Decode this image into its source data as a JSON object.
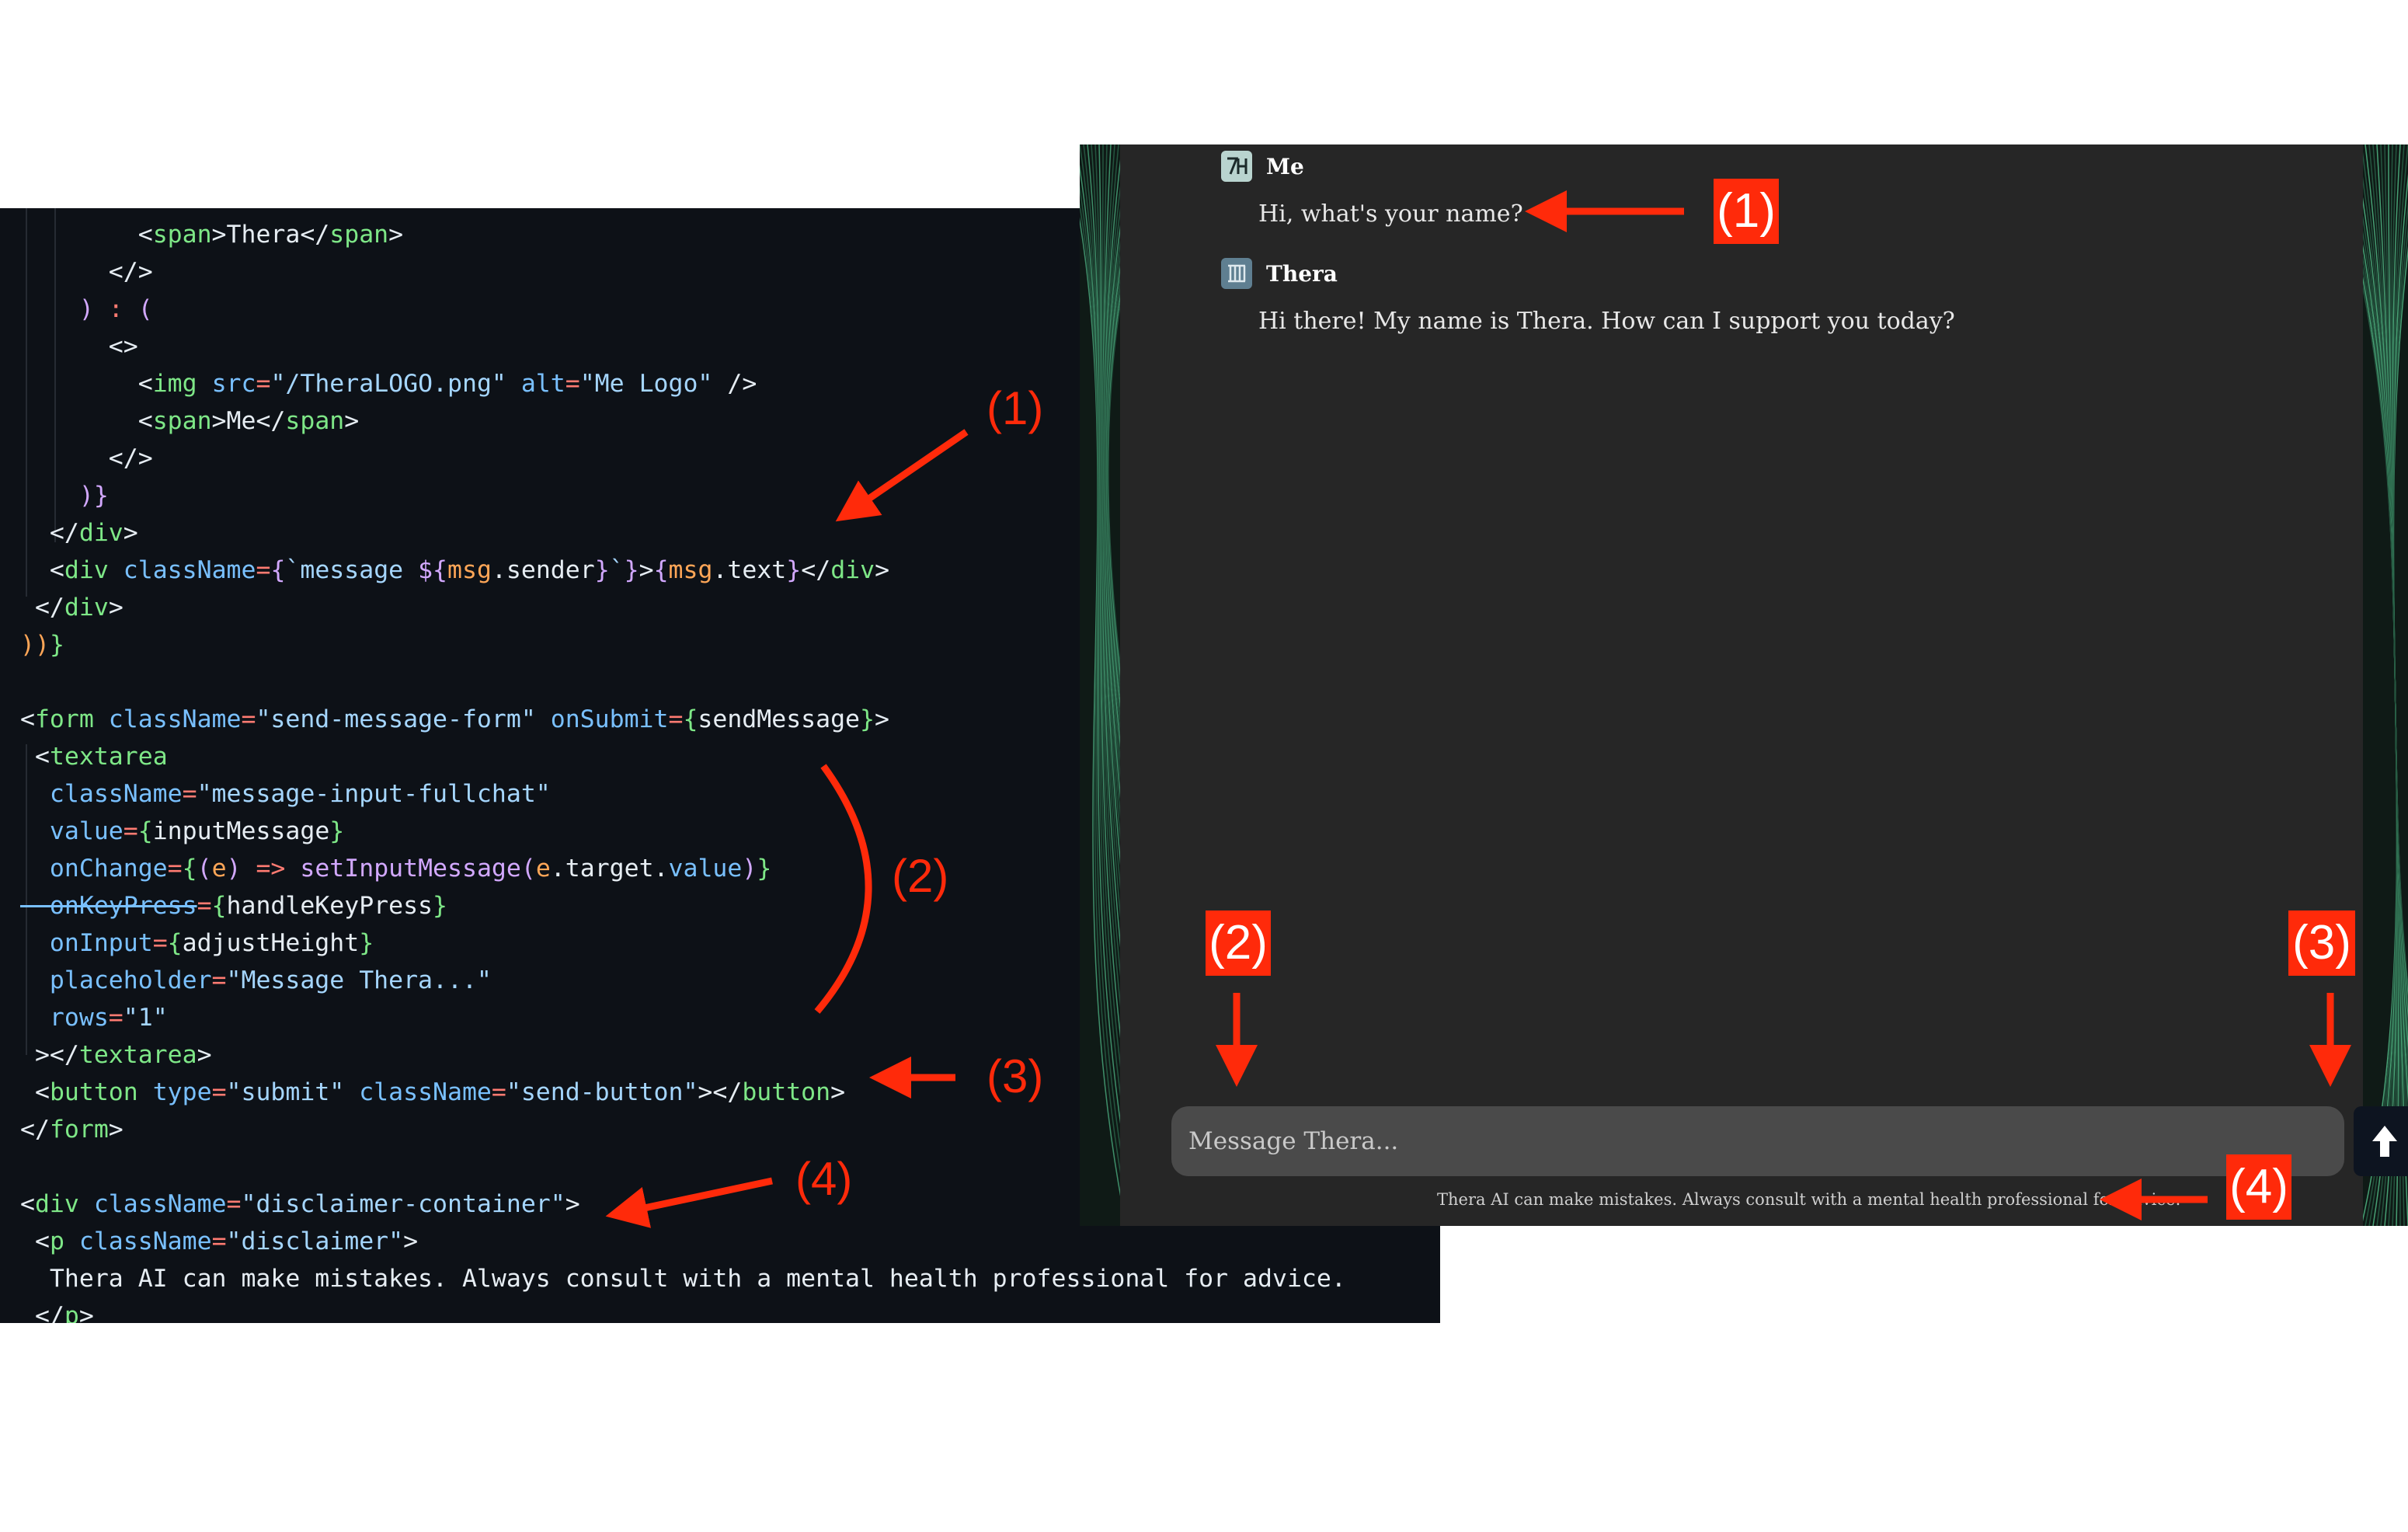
{
  "code": {
    "lines": [
      [
        [
          "br",
          "        <"
        ],
        [
          "tag",
          "span"
        ],
        [
          "br",
          ">"
        ],
        [
          "txt",
          "Thera"
        ],
        [
          "br",
          "</"
        ],
        [
          "tag",
          "span"
        ],
        [
          "br",
          ">"
        ]
      ],
      [
        [
          "br",
          "      </>"
        ]
      ],
      [
        [
          "brp",
          "    ) "
        ],
        [
          "eq",
          ":"
        ],
        [
          "brp",
          " ("
        ]
      ],
      [
        [
          "br",
          "      <>"
        ]
      ],
      [
        [
          "br",
          "        <"
        ],
        [
          "tag",
          "img"
        ],
        [
          "txt",
          " "
        ],
        [
          "attr",
          "src"
        ],
        [
          "eq",
          "="
        ],
        [
          "str",
          "\"/TheraLOGO.png\""
        ],
        [
          "txt",
          " "
        ],
        [
          "attr",
          "alt"
        ],
        [
          "eq",
          "="
        ],
        [
          "str",
          "\"Me Logo\""
        ],
        [
          "br",
          " />"
        ]
      ],
      [
        [
          "br",
          "        <"
        ],
        [
          "tag",
          "span"
        ],
        [
          "br",
          ">"
        ],
        [
          "txt",
          "Me"
        ],
        [
          "br",
          "</"
        ],
        [
          "tag",
          "span"
        ],
        [
          "br",
          ">"
        ]
      ],
      [
        [
          "br",
          "      </>"
        ]
      ],
      [
        [
          "brp",
          "    )}"
        ]
      ],
      [
        [
          "br",
          "  </"
        ],
        [
          "tag",
          "div"
        ],
        [
          "br",
          ">"
        ]
      ],
      [
        [
          "br",
          "  <"
        ],
        [
          "tag",
          "div"
        ],
        [
          "txt",
          " "
        ],
        [
          "attr",
          "className"
        ],
        [
          "eq",
          "="
        ],
        [
          "br1",
          "{"
        ],
        [
          "str",
          "`message "
        ],
        [
          "br1",
          "${"
        ],
        [
          "var",
          "msg"
        ],
        [
          "txt",
          "."
        ],
        [
          "txt",
          "sender"
        ],
        [
          "br1",
          "}"
        ],
        [
          "str",
          "`"
        ],
        [
          "br1",
          "}"
        ],
        [
          "br",
          ">"
        ],
        [
          "br1",
          "{"
        ],
        [
          "var",
          "msg"
        ],
        [
          "txt",
          ".text"
        ],
        [
          "br1",
          "}"
        ],
        [
          "br",
          "</"
        ],
        [
          "tag",
          "div"
        ],
        [
          "br",
          ">"
        ]
      ],
      [
        [
          "br",
          " </"
        ],
        [
          "tag",
          "div"
        ],
        [
          "br",
          ">"
        ]
      ],
      [
        [
          "bro",
          "))"
        ],
        [
          "br2",
          "}"
        ]
      ],
      [
        [
          "txt",
          ""
        ]
      ],
      [
        [
          "br",
          "<"
        ],
        [
          "tag",
          "form"
        ],
        [
          "txt",
          " "
        ],
        [
          "attr",
          "className"
        ],
        [
          "eq",
          "="
        ],
        [
          "str",
          "\"send-message-form\""
        ],
        [
          "txt",
          " "
        ],
        [
          "attr",
          "onSubmit"
        ],
        [
          "eq",
          "="
        ],
        [
          "br2",
          "{"
        ],
        [
          "txt",
          "sendMessage"
        ],
        [
          "br2",
          "}"
        ],
        [
          "br",
          ">"
        ]
      ],
      [
        [
          "br",
          " <"
        ],
        [
          "tag",
          "textarea"
        ]
      ],
      [
        [
          "attr",
          "  className"
        ],
        [
          "eq",
          "="
        ],
        [
          "str",
          "\"message-input-fullchat\""
        ]
      ],
      [
        [
          "attr",
          "  value"
        ],
        [
          "eq",
          "="
        ],
        [
          "br2",
          "{"
        ],
        [
          "txt",
          "inputMessage"
        ],
        [
          "br2",
          "}"
        ]
      ],
      [
        [
          "attr",
          "  onChange"
        ],
        [
          "eq",
          "="
        ],
        [
          "br2",
          "{"
        ],
        [
          "br1",
          "("
        ],
        [
          "var",
          "e"
        ],
        [
          "br1",
          ")"
        ],
        [
          "txt",
          " "
        ],
        [
          "eq",
          "=>"
        ],
        [
          "txt",
          " "
        ],
        [
          "fn",
          "setInputMessage"
        ],
        [
          "br1",
          "("
        ],
        [
          "var",
          "e"
        ],
        [
          "txt",
          ".target."
        ],
        [
          "attr",
          "value"
        ],
        [
          "br1",
          ")"
        ],
        [
          "br2",
          "}"
        ]
      ],
      [
        [
          "strike",
          "  onKeyPress"
        ],
        [
          "eq",
          "="
        ],
        [
          "br2",
          "{"
        ],
        [
          "txt",
          "handleKeyPress"
        ],
        [
          "br2",
          "}"
        ]
      ],
      [
        [
          "attr",
          "  onInput"
        ],
        [
          "eq",
          "="
        ],
        [
          "br2",
          "{"
        ],
        [
          "txt",
          "adjustHeight"
        ],
        [
          "br2",
          "}"
        ]
      ],
      [
        [
          "attr",
          "  placeholder"
        ],
        [
          "eq",
          "="
        ],
        [
          "str",
          "\"Message Thera...\""
        ]
      ],
      [
        [
          "attr",
          "  rows"
        ],
        [
          "eq",
          "="
        ],
        [
          "str",
          "\"1\""
        ]
      ],
      [
        [
          "br",
          " ></"
        ],
        [
          "tag",
          "textarea"
        ],
        [
          "br",
          ">"
        ]
      ],
      [
        [
          "br",
          " <"
        ],
        [
          "tag",
          "button"
        ],
        [
          "txt",
          " "
        ],
        [
          "attr",
          "type"
        ],
        [
          "eq",
          "="
        ],
        [
          "str",
          "\"submit\""
        ],
        [
          "txt",
          " "
        ],
        [
          "attr",
          "className"
        ],
        [
          "eq",
          "="
        ],
        [
          "str",
          "\"send-button\""
        ],
        [
          "br",
          "></"
        ],
        [
          "tag",
          "button"
        ],
        [
          "br",
          ">"
        ]
      ],
      [
        [
          "br",
          "</"
        ],
        [
          "tag",
          "form"
        ],
        [
          "br",
          ">"
        ]
      ],
      [
        [
          "txt",
          ""
        ]
      ],
      [
        [
          "br",
          "<"
        ],
        [
          "tag",
          "div"
        ],
        [
          "txt",
          " "
        ],
        [
          "attr",
          "className"
        ],
        [
          "eq",
          "="
        ],
        [
          "str",
          "\"disclaimer-container\""
        ],
        [
          "br",
          ">"
        ]
      ],
      [
        [
          "br",
          " <"
        ],
        [
          "tag",
          "p"
        ],
        [
          "txt",
          " "
        ],
        [
          "attr",
          "className"
        ],
        [
          "eq",
          "="
        ],
        [
          "str",
          "\"disclaimer\""
        ],
        [
          "br",
          ">"
        ]
      ],
      [
        [
          "txt",
          "  Thera AI can make mistakes. Always consult with a mental health professional for advice."
        ]
      ],
      [
        [
          "br",
          " </"
        ],
        [
          "tag",
          "p"
        ],
        [
          "br",
          ">"
        ]
      ]
    ]
  },
  "chat": {
    "messages": [
      {
        "sender": "Me",
        "text": "Hi, what's your name?"
      },
      {
        "sender": "Thera",
        "text": "Hi there! My name is Thera. How can I support you today?"
      }
    ],
    "input_placeholder": "Message Thera...",
    "send_icon": "arrow-up-icon",
    "disclaimer": "Thera AI can make mistakes. Always consult with a mental health professional for advice."
  },
  "annotations": {
    "code": [
      "(1)",
      "(2)",
      "(3)",
      "(4)"
    ],
    "ui": [
      "(1)",
      "(2)",
      "(3)",
      "(4)"
    ]
  },
  "colors": {
    "annotation": "#ff2a0a",
    "code_bg": "#0d1117",
    "chat_bg": "#262626",
    "input_bg": "#4a4a4a",
    "send_button_bg": "#0d1420"
  }
}
